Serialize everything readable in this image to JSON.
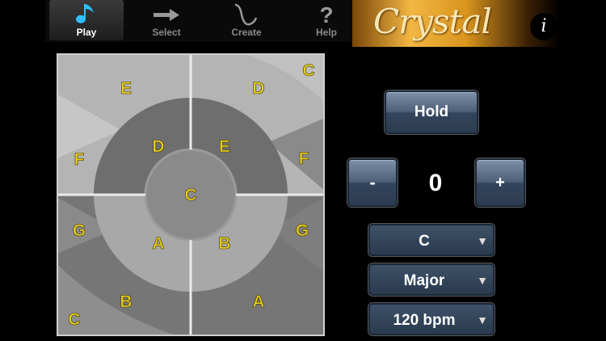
{
  "tabs": [
    {
      "label": "Play",
      "icon": "music-note-icon",
      "active": true
    },
    {
      "label": "Select",
      "icon": "arrow-right-icon",
      "active": false
    },
    {
      "label": "Create",
      "icon": "waveform-icon",
      "active": false
    },
    {
      "label": "Help",
      "icon": "question-mark-icon",
      "active": false
    }
  ],
  "banner": {
    "title": "Crystal",
    "info_label": "i"
  },
  "keypad": {
    "center": "C",
    "inner_ring": [
      "D",
      "E",
      "A",
      "B"
    ],
    "outer_ring": [
      "E",
      "D",
      "C",
      "F",
      "F",
      "G",
      "G",
      "B",
      "A",
      "C"
    ]
  },
  "controls": {
    "hold_label": "Hold",
    "minus_label": "-",
    "plus_label": "+",
    "transpose_value": "0",
    "key": "C",
    "scale": "Major",
    "tempo": "120 bpm",
    "dropdown_arrow": "▼"
  },
  "colors": {
    "note_label": "#e6cf1e",
    "banner_gold": "#f2b642",
    "button_blue": "#4d6078"
  }
}
